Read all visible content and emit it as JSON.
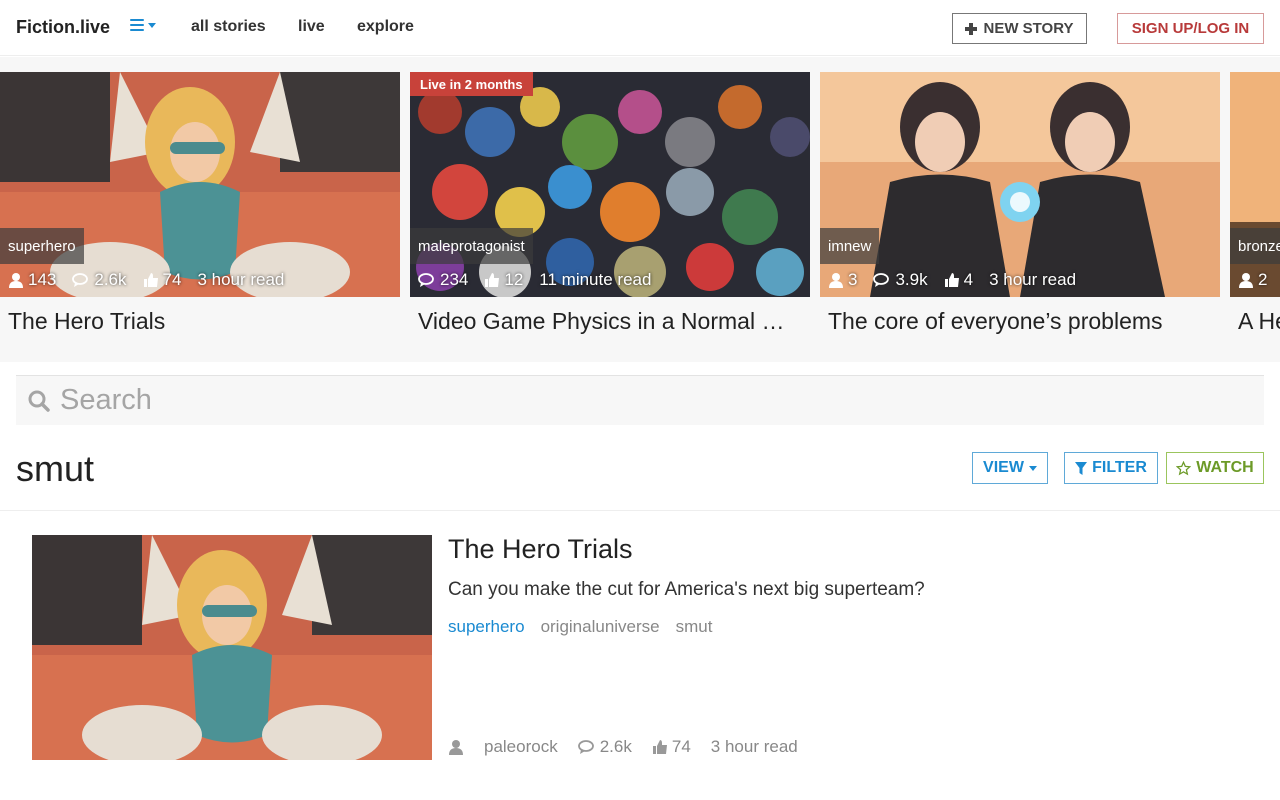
{
  "header": {
    "brand": "Fiction.live",
    "nav": [
      "all stories",
      "live",
      "explore"
    ],
    "new_story_label": "NEW STORY",
    "signup_label": "SIGN UP/LOG IN",
    "menu_icon": "hamburger-icon"
  },
  "featured": [
    {
      "tag": "superhero",
      "live": "",
      "readers": "143",
      "comments": "2.6k",
      "likes": "74",
      "read_time": "3 hour read",
      "title": "The Hero Trials"
    },
    {
      "tag": "maleprotagonist",
      "live": "Live in 2 months",
      "readers": "",
      "comments": "234",
      "likes": "12",
      "read_time": "11 minute read",
      "title": "Video Game Physics in a Normal …"
    },
    {
      "tag": "imnew",
      "live": "",
      "readers": "3",
      "comments": "3.9k",
      "likes": "4",
      "read_time": "3 hour read",
      "title": "The core of everyone’s problems"
    },
    {
      "tag": "bronze",
      "live": "",
      "readers": "2",
      "comments": "",
      "likes": "",
      "read_time": "",
      "title": "A He"
    }
  ],
  "search": {
    "placeholder": "Search"
  },
  "results": {
    "title": "smut",
    "view_label": "VIEW",
    "filter_label": "FILTER",
    "watch_label": "WATCH"
  },
  "story": {
    "title": "The Hero Trials",
    "description": "Can you make the cut for America's next big superteam?",
    "tags": [
      "superhero",
      "originaluniverse",
      "smut"
    ],
    "author": "paleorock",
    "comments": "2.6k",
    "likes": "74",
    "read_time": "3 hour read"
  },
  "colors": {
    "accent": "#1a8ad1",
    "signup": "#b83a3a",
    "watch": "#6c9a27",
    "live_badge": "#c8423a"
  }
}
